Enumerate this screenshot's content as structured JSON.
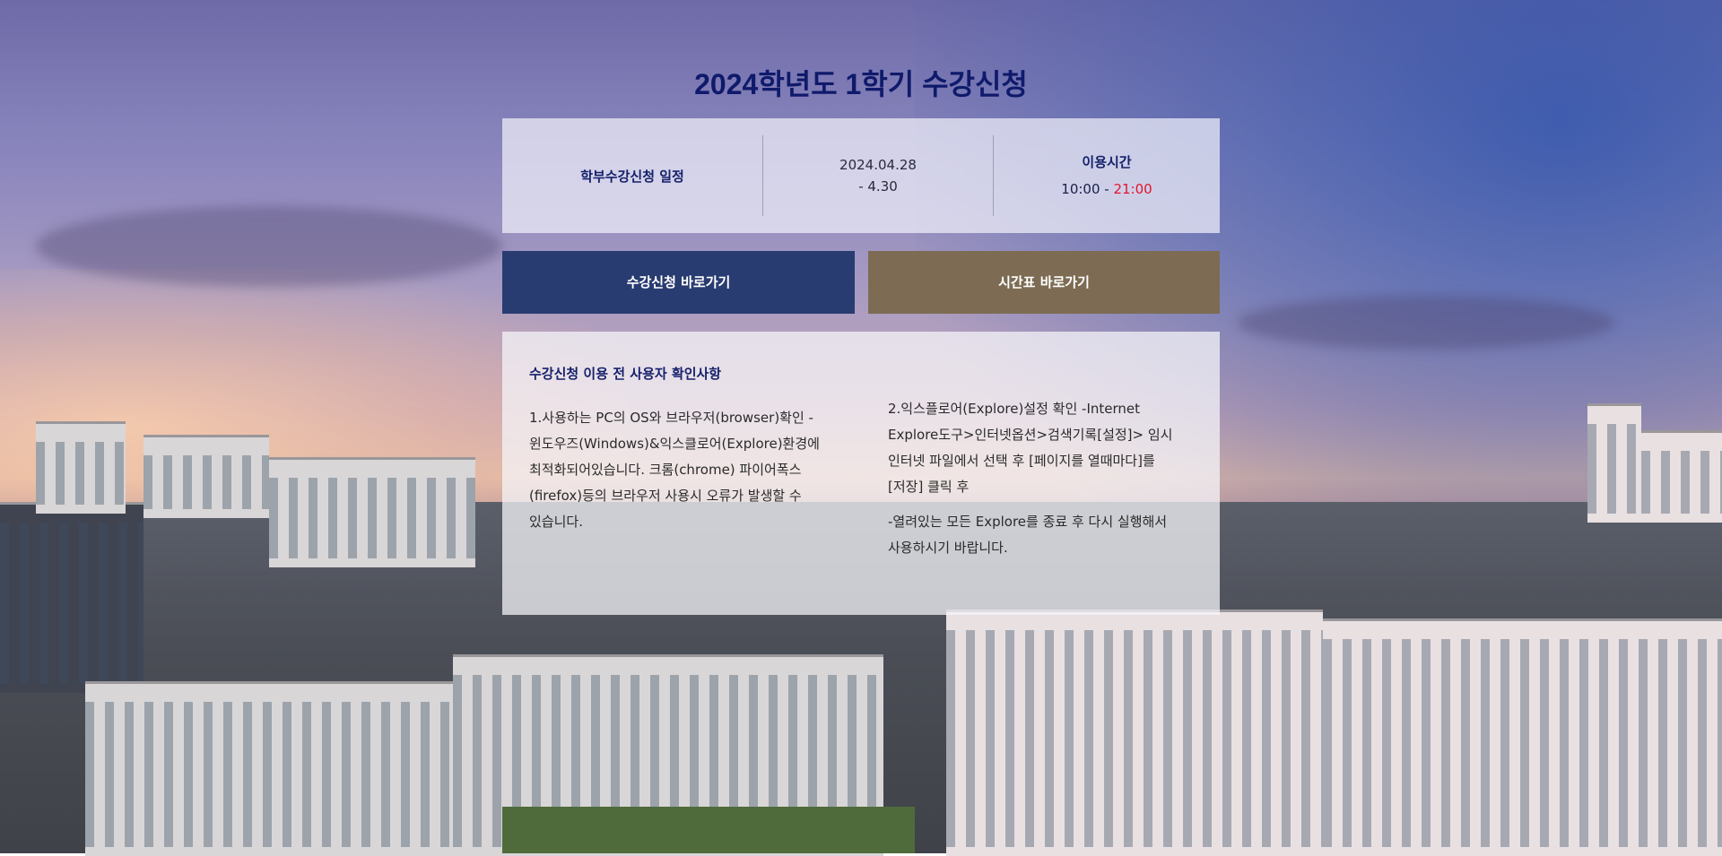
{
  "page": {
    "title": "2024학년도 1학기 수강신청"
  },
  "schedule": {
    "label": "학부수강신청 일정",
    "date_line1": "2024.04.28",
    "date_line2": "- 4.30",
    "hours_label": "이용시간",
    "hours_start": "10:00 - ",
    "hours_end": "21:00",
    "hours_end_color": "#e5142b"
  },
  "buttons": {
    "registration": "수강신청 바로가기",
    "timetable": "시간표 바로가기"
  },
  "notice": {
    "title": "수강신청 이용 전 사용자 확인사항",
    "item1": "1.사용하는 PC의 OS와 브라우저(browser)확인 -윈도우즈(Windows)&익스클로어(Explore)환경에 최적화되어있습니다. 크롬(chrome) 파이어폭스(firefox)등의 브라우저 사용시 오류가 발생할 수 있습니다.",
    "item2": "2.익스플로어(Explore)설정 확인 -Internet Explore도구>인터넷옵션>검색기록[설정]> 임시 인터넷 파일에서 선택 후 [페이지를 열때마다]를 [저장] 클릭 후",
    "item3": "-열려있는 모든 Explore를 종료 후 다시 실행해서 사용하시기 바랍니다."
  },
  "colors": {
    "title": "#0f1a6b",
    "primary_button": "#293c71",
    "secondary_button": "#7d6c53"
  }
}
